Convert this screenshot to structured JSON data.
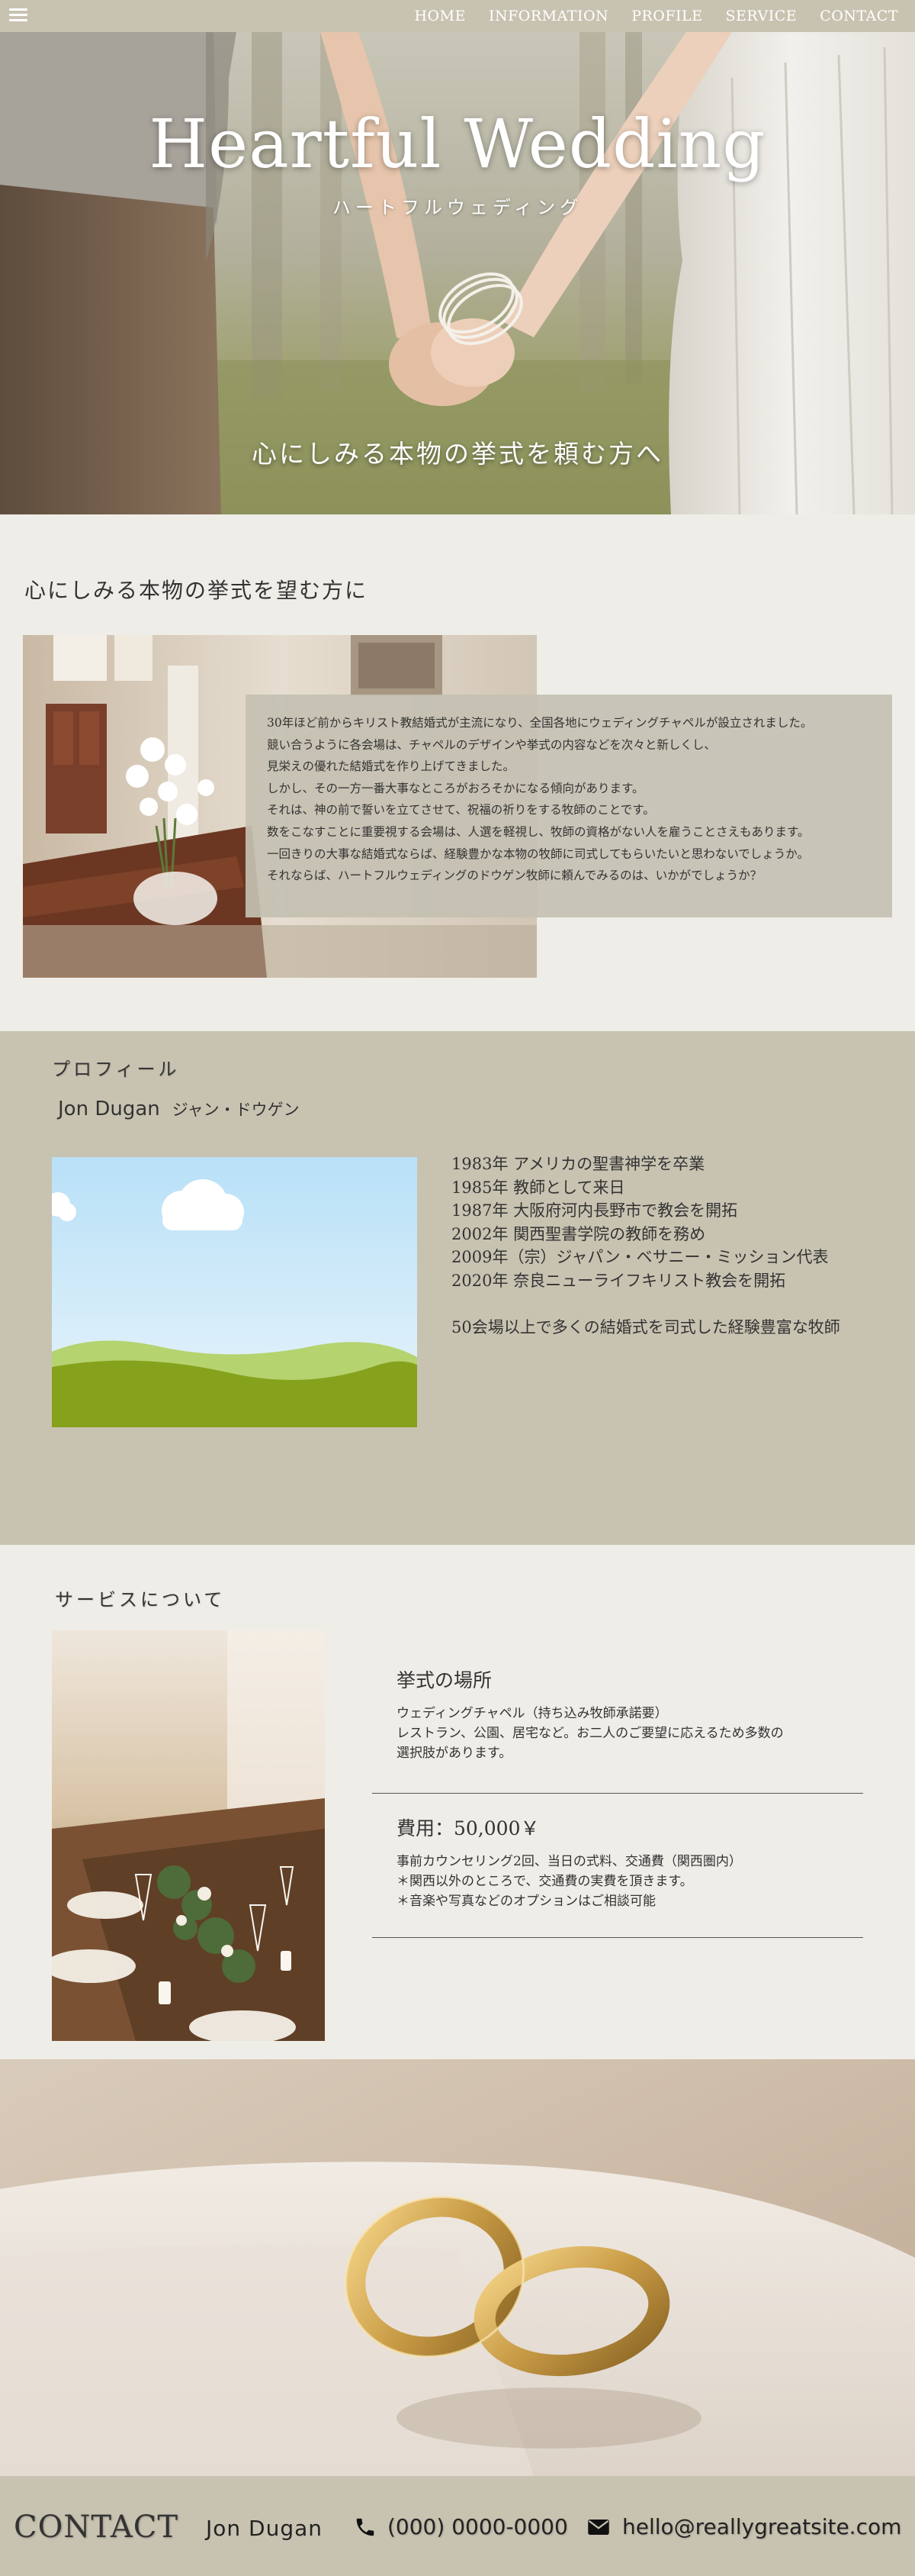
{
  "nav": {
    "menu_icon": "hamburger-menu-icon",
    "links": [
      "HOME",
      "INFORMATION",
      "PROFILE",
      "SERVICE",
      "CONTACT"
    ]
  },
  "hero": {
    "title": "Heartful Wedding",
    "subtitle": "ハートフルウェディング",
    "tagline": "心にしみる本物の挙式を頼む方へ"
  },
  "intro": {
    "heading": "心にしみる本物の挙式を望む方に",
    "lines": [
      "30年ほど前からキリスト教結婚式が主流になり、全国各地にウェディングチャペルが設立されました。",
      "競い合うように各会場は、チャペルのデザインや挙式の内容などを次々と新しくし、",
      "見栄えの優れた結婚式を作り上げてきました。",
      "しかし、その一方一番大事なところがおろそかになる傾向があります。",
      "それは、神の前で誓いを立てさせて、祝福の祈りをする牧師のことです。",
      "数をこなすことに重要視する会場は、人選を軽視し、牧師の資格がない人を雇うことさえもあります。",
      "一回きりの大事な結婚式ならば、経験豊かな本物の牧師に司式してもらいたいと思わないでしょうか。",
      "それならば、ハートフルウェディングのドウゲン牧師に頼んでみるのは、いかがでしょうか？"
    ]
  },
  "profile": {
    "heading": "プロフィール",
    "name_en": "Jon Dugan",
    "name_jp": "ジャン・ドウゲン",
    "history": [
      "1983年 アメリカの聖書神学を卒業",
      "1985年 教師として来日",
      "1987年 大阪府河内長野市で教会を開拓",
      "2002年 関西聖書学院の教師を務め",
      "2009年（宗）ジャパン・ベサニー・ミッション代表",
      "2020年 奈良ニューライフキリスト教会を開拓"
    ],
    "summary": "50会場以上で多くの結婚式を司式した経験豊富な牧師"
  },
  "service": {
    "heading": "サービスについて",
    "venue": {
      "title": "挙式の場所",
      "lines": [
        "ウェディングチャペル（持ち込み牧師承諾要）",
        "レストラン、公園、居宅など。お二人のご要望に応えるため多数の",
        "選択肢があります。"
      ]
    },
    "fee": {
      "title": "費用：50,000￥",
      "lines": [
        "事前カウンセリング2回、当日の式料、交通費（関西圏内）",
        "＊関西以外のところで、交通費の実費を頂きます。",
        "＊音楽や写真などのオプションはご相談可能"
      ]
    }
  },
  "footer": {
    "title": "CONTACT",
    "name": "Jon  Dugan",
    "phone": "(000) 0000-0000",
    "email": "hello@reallygreatsite.com",
    "phone_icon": "phone-icon",
    "mail_icon": "mail-icon"
  }
}
